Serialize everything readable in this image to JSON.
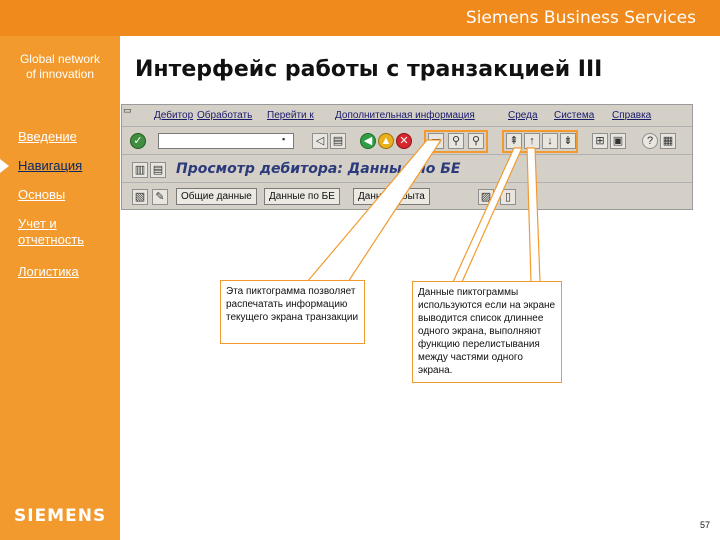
{
  "header": {
    "brand": "Siemens Business Services"
  },
  "sidebar": {
    "tagline_line1": "Global network",
    "tagline_line2": "of innovation",
    "items": [
      {
        "label": "Введение"
      },
      {
        "label": "Навигация",
        "active": true
      },
      {
        "label": "Основы"
      },
      {
        "label": "Учет и",
        "label2": "отчетность"
      },
      {
        "label": "Логистика"
      }
    ],
    "logo": "SIEMENS"
  },
  "slide": {
    "title": "Интерфейс  работы с транзакцией III",
    "page_number": "57"
  },
  "sap": {
    "menu": [
      "Дебитор",
      "Обработать",
      "Перейти к",
      "Дополнительная информация",
      "Среда",
      "Система",
      "Справка"
    ],
    "screen_title": "Просмотр дебитора: Данные по БЕ",
    "app_buttons": [
      "Общие данные",
      "Данные по БЕ",
      "Данные сбыта"
    ],
    "cmd_value": ""
  },
  "callouts": {
    "print": "Эта пиктограмма позволяет распечатать информацию текущего экрана транзакции",
    "scroll": "Данные пиктограммы используются если на экране выводится список длиннее одного экрана, выполняют функцию перелистывания между частями одного экрана."
  },
  "colors": {
    "orange": "#f29a2e",
    "header_orange": "#f08a1c",
    "sap_gray": "#d4d0c8",
    "title_blue": "#2a3a7a"
  }
}
